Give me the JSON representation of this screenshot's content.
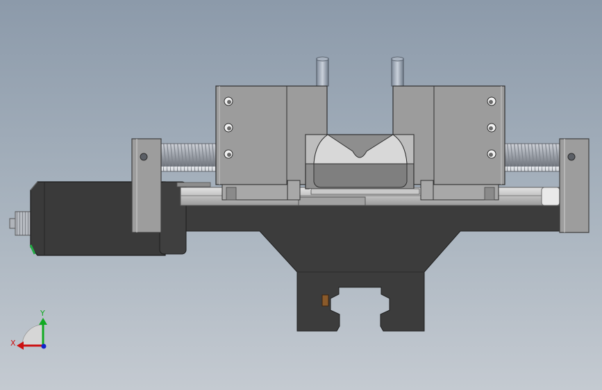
{
  "viewport": {
    "background_top": "#8c9aaa",
    "background_bottom": "#c4cad1"
  },
  "triad": {
    "x_label": "X",
    "y_label": "Y",
    "x_color": "#cc1111",
    "y_color": "#11aa22",
    "z_color": "#1122cc"
  },
  "colors": {
    "base": "#3c3c3c",
    "carriage": "#9c9c9c",
    "rail": "#c8c8c8",
    "screw": "#b9bdc4",
    "motor": "#3a3a3a",
    "accent_brown": "#8a5a2a",
    "accent_green": "#22aa44"
  }
}
